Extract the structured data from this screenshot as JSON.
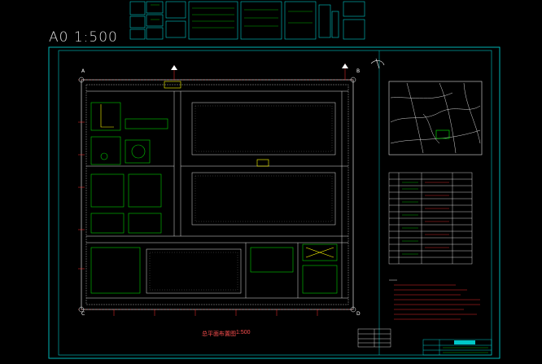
{
  "drawing": {
    "scale_title": "A0 1:500",
    "plan_title": "总平面布置图",
    "plan_scale": "1:500"
  },
  "axis_labels": {
    "a": "A",
    "b": "B",
    "c": "C",
    "d": "D"
  },
  "colors": {
    "background": "#000000",
    "frame": "#00c8c8",
    "road": "#e0e0e0",
    "building": "#00d000",
    "annotation": "#ff3030",
    "detail": "#ffff00"
  }
}
